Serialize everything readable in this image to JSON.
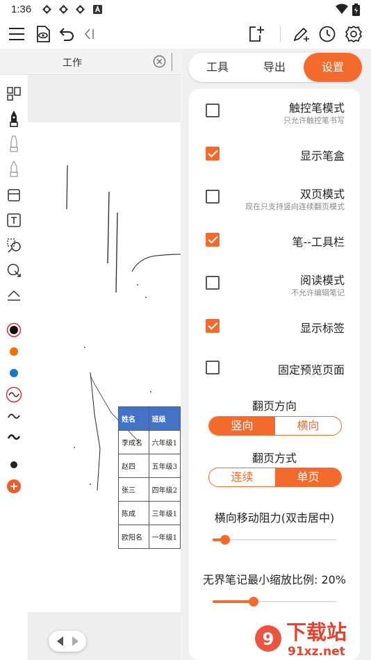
{
  "status_bar": {
    "time": "1:36",
    "notification_icons": [
      "app-icon",
      "app-icon",
      "app-icon",
      "a-icon"
    ],
    "system_icons": [
      "wifi-icon",
      "battery-icon"
    ]
  },
  "toolbar": {
    "left_icons": [
      "menu-icon",
      "eye-doc-icon",
      "undo-icon",
      "collapse-left-icon"
    ],
    "right_icons": [
      "add-page-icon",
      "pen-plus-icon",
      "clock-icon",
      "settings-icon"
    ]
  },
  "tab": {
    "label": "工作"
  },
  "left_tools": {
    "icons": [
      "layout-icon",
      "pen-icon",
      "marker-icon",
      "highlighter-icon",
      "eraser-icon",
      "text-icon",
      "lasso-icon",
      "shape-icon",
      "ruler-icon"
    ],
    "colors": [
      {
        "name": "black",
        "value": "#111111",
        "selected": true
      },
      {
        "name": "orange",
        "value": "#ff6a00",
        "selected": false
      },
      {
        "name": "blue",
        "value": "#1a73c8",
        "selected": false
      }
    ],
    "strokes": [
      "wave-stroke-selected",
      "wave-stroke",
      "wave-stroke-bold"
    ],
    "size_dot": "#222222",
    "add_button": "add-icon"
  },
  "document": {
    "table": {
      "headers": [
        "姓名",
        "班级"
      ],
      "rows": [
        [
          "李成名",
          "六年级1"
        ],
        [
          "赵四",
          "五年级3"
        ],
        [
          "张三",
          "四年级2"
        ],
        [
          "陈成",
          "三年级1"
        ],
        [
          "欧阳名",
          "一年级1"
        ]
      ]
    }
  },
  "panel": {
    "tabs": [
      {
        "label": "工具",
        "active": false
      },
      {
        "label": "导出",
        "active": false
      },
      {
        "label": "设置",
        "active": true
      }
    ],
    "options": [
      {
        "title": "触控笔模式",
        "subtitle": "只允许触控笔书写",
        "checked": false
      },
      {
        "title": "显示笔盒",
        "subtitle": "",
        "checked": true
      },
      {
        "title": "双页模式",
        "subtitle": "现在只支持竖向连续翻页模式",
        "checked": false
      },
      {
        "title": "笔--工具栏",
        "subtitle": "",
        "checked": true
      },
      {
        "title": "阅读模式",
        "subtitle": "不允许编辑笔记",
        "checked": false
      },
      {
        "title": "显示标签",
        "subtitle": "",
        "checked": true
      },
      {
        "title": "固定预览页面",
        "subtitle": "",
        "checked": false
      }
    ],
    "page_direction": {
      "label": "翻页方向",
      "options": [
        {
          "label": "竖向",
          "active": true
        },
        {
          "label": "横向",
          "active": false
        }
      ]
    },
    "page_mode": {
      "label": "翻页方式",
      "options": [
        {
          "label": "连续",
          "active": false
        },
        {
          "label": "单页",
          "active": true
        }
      ]
    },
    "resistance": {
      "label": "横向移动阻力(双击居中)",
      "value": 0.1
    },
    "min_zoom": {
      "label": "无界笔记最小缩放比例: 20%",
      "value": 0.33
    }
  },
  "watermark": {
    "brand": "下载站",
    "domain": "91xz.net"
  },
  "colors": {
    "accent": "#f26b2d"
  }
}
